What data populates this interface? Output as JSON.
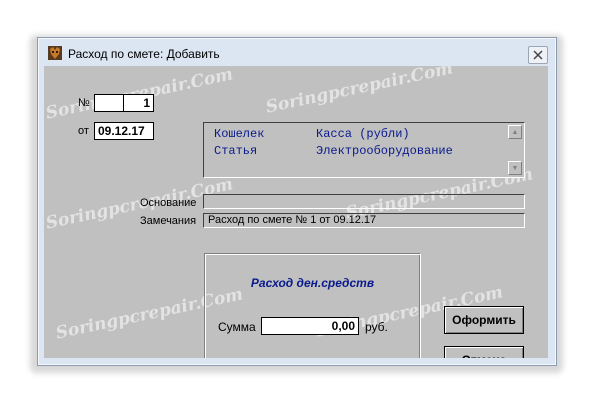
{
  "window": {
    "title": "Расход по смете: Добавить"
  },
  "form": {
    "number_label": "№",
    "number_prefix": "",
    "number_value": "1",
    "date_label": "от",
    "date_value": "09.12.17",
    "info": [
      {
        "key": "Кошелек",
        "value": "Касса (рубли)"
      },
      {
        "key": "Статья",
        "value": "Электрооборудование"
      }
    ],
    "basis_label": "Основание",
    "basis_value": "",
    "notes_label": "Замечания",
    "notes_value": "Расход по смете № 1 от 09.12.17"
  },
  "expense_group": {
    "title": "Расход ден.средств",
    "amount_label": "Сумма",
    "amount_value": "0,00",
    "currency": "руб."
  },
  "buttons": {
    "submit": "Оформить",
    "cancel": "Отмена"
  },
  "watermark": "Soringpcrepair.Com",
  "icons": {
    "app": "app-logo-icon",
    "close": "close-icon",
    "scroll_up": "arrow-up-icon",
    "scroll_down": "arrow-down-icon"
  }
}
